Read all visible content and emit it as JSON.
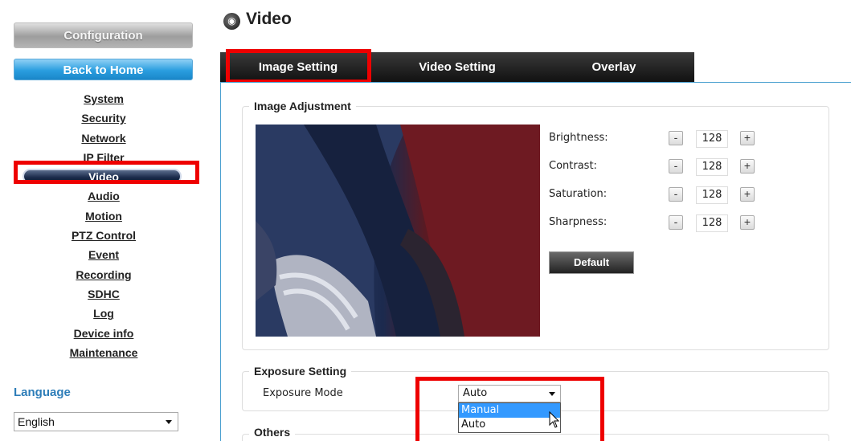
{
  "sidebar": {
    "config_label": "Configuration",
    "home_label": "Back to Home",
    "items": [
      "System",
      "Security",
      "Network",
      "IP Filter",
      "Video",
      "Audio",
      "Motion",
      "PTZ Control",
      "Event",
      "Recording",
      "SDHC",
      "Log",
      "Device info",
      "Maintenance"
    ],
    "active_item": "Video",
    "language_title": "Language",
    "language_value": "English"
  },
  "header": {
    "title": "Video"
  },
  "tabs": {
    "image": "Image Setting",
    "video": "Video Setting",
    "overlay": "Overlay",
    "active": "Image Setting"
  },
  "image_adjustment": {
    "legend": "Image Adjustment",
    "brightness_label": "Brightness:",
    "brightness": "128",
    "contrast_label": "Contrast:",
    "contrast": "128",
    "saturation_label": "Saturation:",
    "saturation": "128",
    "sharpness_label": "Sharpness:",
    "sharpness": "128",
    "minus": "-",
    "plus": "+",
    "default_label": "Default"
  },
  "exposure": {
    "legend": "Exposure Setting",
    "mode_label": "Exposure Mode",
    "mode_value": "Auto",
    "options": [
      "Manual",
      "Auto"
    ],
    "highlighted_option": "Manual"
  },
  "others": {
    "legend": "Others"
  },
  "colors": {
    "accent": "#2d7db8",
    "highlight": "#ee0000",
    "selected_option": "#3399ff"
  }
}
